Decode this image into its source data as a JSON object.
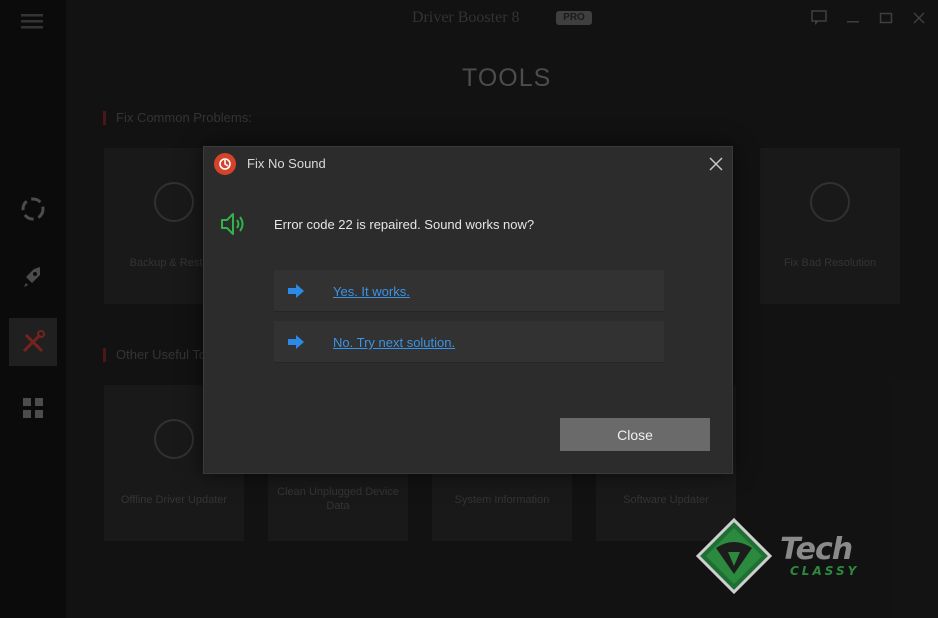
{
  "app": {
    "title": "Driver Booster 8",
    "badge": "PRO",
    "page_title": "TOOLS",
    "sections": [
      {
        "label": "Fix Common Problems:"
      },
      {
        "label": "Other Useful Tools:"
      }
    ],
    "cards_row1": [
      {
        "label": "Backup & Restore"
      },
      {
        "label": "Fix Bad Resolution"
      }
    ],
    "cards_row2": [
      {
        "label": "Offline Driver Updater"
      },
      {
        "label": "Clean Unplugged Device Data"
      },
      {
        "label": "System Information"
      },
      {
        "label": "Software Updater"
      }
    ],
    "sidebar": [
      {
        "icon": "scan-icon"
      },
      {
        "icon": "boost-rocket-icon"
      },
      {
        "icon": "tools-icon",
        "active": true
      },
      {
        "icon": "action-center-icon"
      }
    ]
  },
  "dialog": {
    "title": "Fix No Sound",
    "message": "Error code 22 is repaired. Sound works now?",
    "options": [
      {
        "label": "Yes. It works."
      },
      {
        "label": "No. Try next solution."
      }
    ],
    "close_label": "Close"
  },
  "watermark": {
    "line1": "Tech",
    "line2": "CLASSY"
  },
  "colors": {
    "link": "#3b93e6",
    "speaker": "#2fb34a",
    "dialog_icon": "#d4432a",
    "close_button": "#6a6a6a"
  }
}
